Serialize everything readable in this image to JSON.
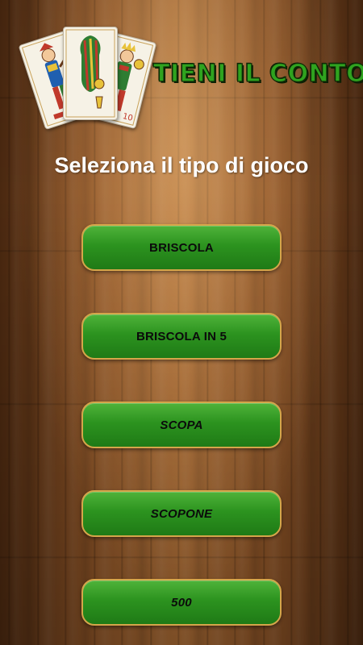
{
  "app": {
    "title": "TIENI IL CONTO",
    "logo_icon": "playing-cards-icon"
  },
  "screen": {
    "heading": "Seleziona il tipo di gioco"
  },
  "game_types": [
    {
      "label": "BRISCOLA",
      "italic": false
    },
    {
      "label": "BRISCOLA IN 5",
      "italic": false
    },
    {
      "label": "SCOPA",
      "italic": true
    },
    {
      "label": "SCOPONE",
      "italic": true
    },
    {
      "label": "500",
      "italic": true
    }
  ],
  "colors": {
    "button_green": "#2c931f",
    "button_border": "#d5a64a",
    "title_green": "#2fa31f",
    "wood_brown": "#8a5226"
  }
}
